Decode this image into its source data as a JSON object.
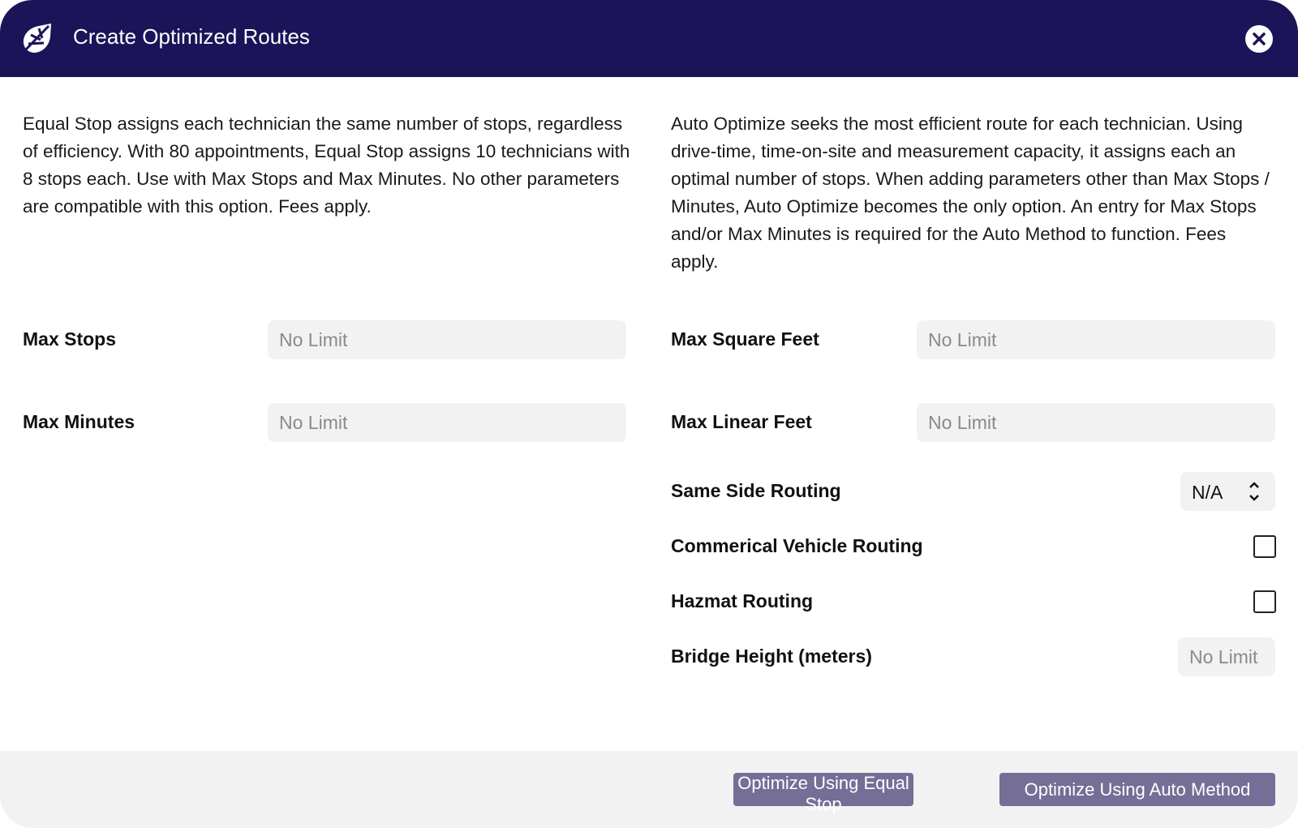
{
  "header": {
    "title": "Create Optimized Routes",
    "logo_icon": "leaf-logo-icon",
    "close_icon": "close-circle-icon"
  },
  "left": {
    "description": "Equal Stop assigns each technician the same number of stops, regardless of efficiency. With 80 appointments, Equal Stop assigns 10 technicians with 8 stops each. Use with Max Stops and Max Minutes. No other parameters are compatible with this option. Fees apply.",
    "max_stops_label": "Max Stops",
    "max_stops_placeholder": "No Limit",
    "max_minutes_label": "Max Minutes",
    "max_minutes_placeholder": "No Limit"
  },
  "right": {
    "description": "Auto Optimize seeks the most efficient route for each technician. Using drive-time, time-on-site and measurement capacity, it assigns each an optimal number of stops. When adding parameters other than Max Stops / Minutes, Auto Optimize becomes the only option. An entry for Max Stops and/or Max Minutes is required for the Auto Method to function. Fees apply.",
    "max_sqft_label": "Max Square Feet",
    "max_sqft_placeholder": "No Limit",
    "max_linear_label": "Max Linear Feet",
    "max_linear_placeholder": "No Limit",
    "same_side_label": "Same Side Routing",
    "same_side_value": "N/A",
    "commercial_label": "Commerical Vehicle Routing",
    "commercial_checked": false,
    "hazmat_label": "Hazmat Routing",
    "hazmat_checked": false,
    "bridge_label": "Bridge Height (meters)",
    "bridge_placeholder": "No Limit"
  },
  "footer": {
    "equal_stop_button": "Optimize Using Equal Stop",
    "auto_button": "Optimize Using Auto Method",
    "button_color": "#756e97"
  },
  "colors": {
    "header_bg": "#1b1458",
    "footer_bg": "#f2f2f2",
    "input_bg": "#f2f2f2"
  }
}
